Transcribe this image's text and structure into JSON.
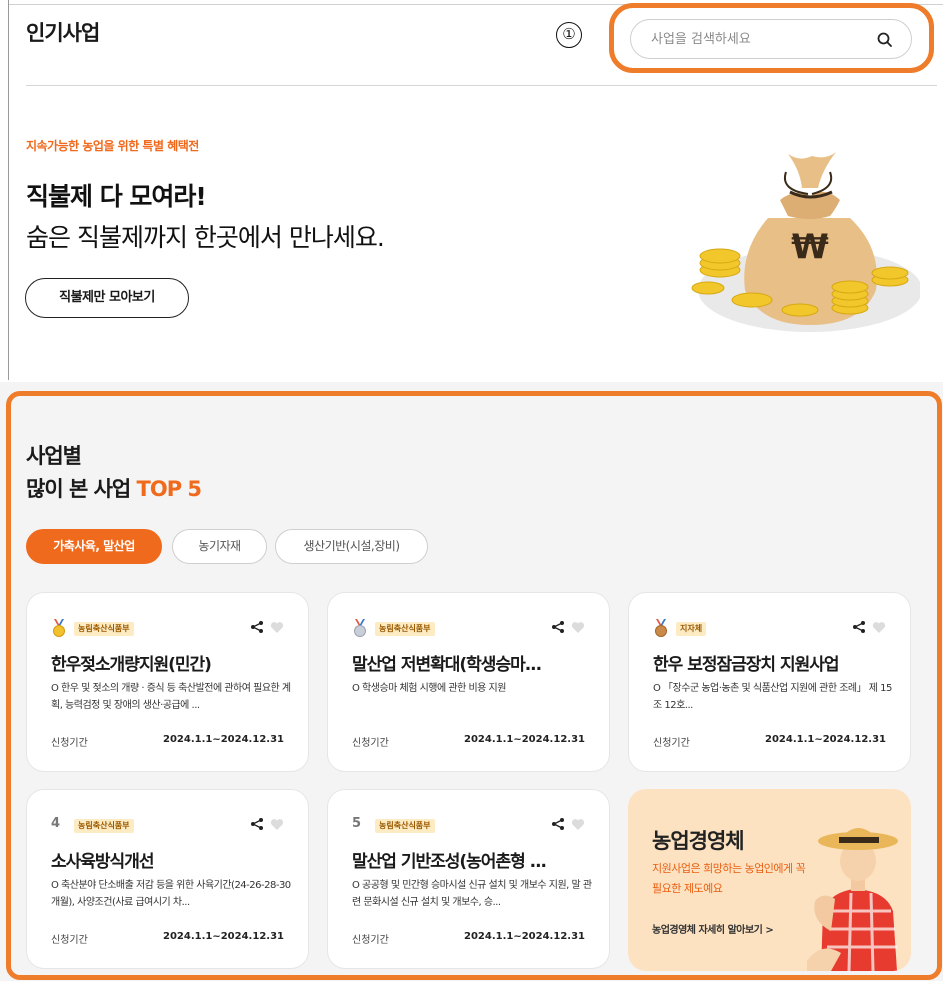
{
  "header": {
    "title": "인기사업",
    "marker": "①",
    "search_placeholder": "사업을 검색하세요"
  },
  "banner": {
    "eyebrow": "지속가능한 농업을 위한 특별 혜택전",
    "headline": "직불제 다 모여라!",
    "subheadline": "숨은 직불제까지 한곳에서 만나세요.",
    "button_label": "직불제만 모아보기"
  },
  "top5": {
    "title_line1": "사업별",
    "title_line2_prefix": "많이 본 사업 ",
    "title_line2_accent": "TOP 5",
    "tabs": [
      {
        "label": "가축사육, 말산업",
        "active": true
      },
      {
        "label": "농기자재",
        "active": false
      },
      {
        "label": "생산기반(시설,장비)",
        "active": false
      }
    ],
    "cards": [
      {
        "rank": "1",
        "rank_icon": "gold-medal-icon",
        "agency": "농림축산식품부",
        "title": "한우젖소개량지원(민간)",
        "description": "O 한우 및 젖소의 개량 · 증식 등 축산발전에 관하여 필요한 계획, 능력검정 및 장애의 생산·공급에 ...",
        "period_label": "신청기간",
        "period": "2024.1.1~2024.12.31"
      },
      {
        "rank": "2",
        "rank_icon": "silver-medal-icon",
        "agency": "농림축산식품부",
        "title": "말산업 저변확대(학생승마...",
        "description": "O 학생승마 체험 시행에 관한 비용 지원",
        "period_label": "신청기간",
        "period": "2024.1.1~2024.12.31"
      },
      {
        "rank": "3",
        "rank_icon": "bronze-medal-icon",
        "agency": "지자체",
        "title": "한우 보정잠금장치 지원사업",
        "description": "O 「장수군 농업·농촌 및 식품산업 지원에 관한 조례」 제 15조 12호...",
        "period_label": "신청기간",
        "period": "2024.1.1~2024.12.31"
      },
      {
        "rank": "4",
        "rank_icon": "",
        "agency": "농림축산식품부",
        "title": "소사육방식개선",
        "description": "O 축산분야 단소배출 저감 등을 위한 사육기간(24-26-28-30개월), 사양조건(사료 급여시기 차...",
        "period_label": "신청기간",
        "period": "2024.1.1~2024.12.31"
      },
      {
        "rank": "5",
        "rank_icon": "",
        "agency": "농림축산식품부",
        "title": "말산업 기반조성(농어촌형 ...",
        "description": "O 공공형 및 민간형 승마시설 신규 설치 및 개보수 지원, 말 관련 문화시설 신규 설치 및 개보수, 승...",
        "period_label": "신청기간",
        "period": "2024.1.1~2024.12.31"
      }
    ],
    "promo": {
      "title": "농업경영체",
      "description": "지원사업은 희망하는 농업인에게 꼭 필요한 제도예요",
      "link_label": "농업경영체 자세히 알아보기 >"
    }
  },
  "colors": {
    "accent": "#f06a1d",
    "highlight_outline": "#ee7c2a",
    "agency_badge_bg": "#fdebc4",
    "promo_bg": "#fde2c2"
  }
}
